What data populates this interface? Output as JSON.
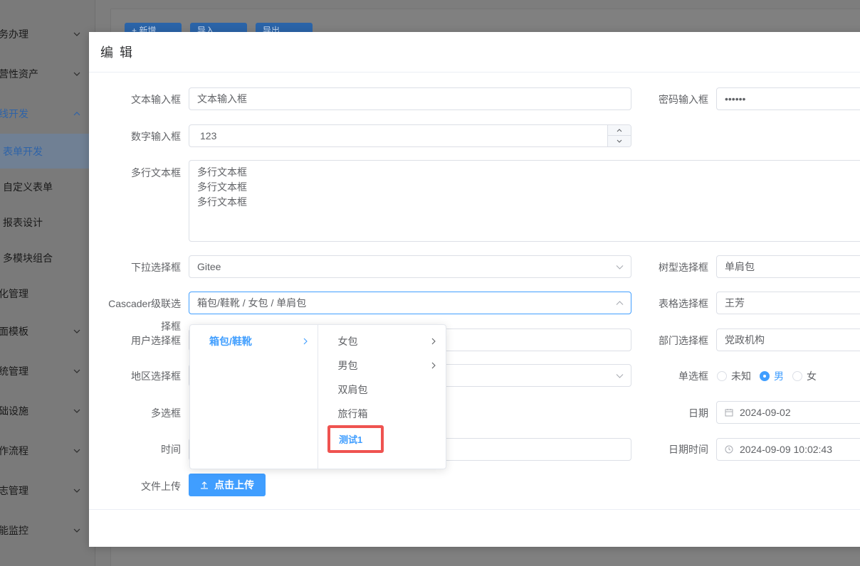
{
  "sidebar": {
    "items": [
      {
        "label": "务办理"
      },
      {
        "label": "营性资产"
      },
      {
        "label": "线开发"
      },
      {
        "label": "表单开发"
      },
      {
        "label": "自定义表单"
      },
      {
        "label": "报表设计"
      },
      {
        "label": "多模块组合"
      },
      {
        "label": "化管理"
      },
      {
        "label": "面模板"
      },
      {
        "label": "统管理"
      },
      {
        "label": "础设施"
      },
      {
        "label": "作流程"
      },
      {
        "label": "志管理"
      },
      {
        "label": "能监控"
      }
    ]
  },
  "toolbar": {
    "buttons": [
      {
        "label": "+ 新增"
      },
      {
        "label": "导入"
      },
      {
        "label": "导出"
      }
    ]
  },
  "dialog": {
    "title": "编 辑",
    "fields": {
      "text_label": "文本输入框",
      "text_value": "文本输入框",
      "password_label": "密码输入框",
      "password_value": "••••••",
      "number_label": "数字输入框",
      "number_value": "123",
      "textarea_label": "多行文本框",
      "textarea_lines": [
        "多行文本框",
        "多行文本框",
        "多行文本框"
      ],
      "select_label": "下拉选择框",
      "select_value": "Gitee",
      "tree_label": "树型选择框",
      "tree_value": "单肩包",
      "cascader_label": "Cascader级联选",
      "cascader_label_2": "择框",
      "cascader_value": "箱包/鞋靴 /  女包 / 单肩包",
      "table_label": "表格选择框",
      "table_value": "王芳",
      "user_label": "用户选择框",
      "dept_label": "部门选择框",
      "dept_value": "党政机构",
      "region_label": "地区选择框",
      "radio_label": "单选框",
      "radio_options": [
        "未知",
        "男",
        "女"
      ],
      "checkbox_label": "多选框",
      "date_label": "日期",
      "date_value": "2024-09-02",
      "time_label": "时间",
      "datetime_label": "日期时间",
      "datetime_value": "2024-09-09 10:02:43",
      "upload_label": "文件上传",
      "upload_button": "点击上传"
    },
    "cascader_menu": {
      "level1": [
        "箱包/鞋靴"
      ],
      "level2": [
        "女包",
        "男包",
        "双肩包",
        "旅行箱",
        "测试1"
      ]
    }
  },
  "colors": {
    "primary": "#409eff",
    "highlight": "#ef5350"
  }
}
